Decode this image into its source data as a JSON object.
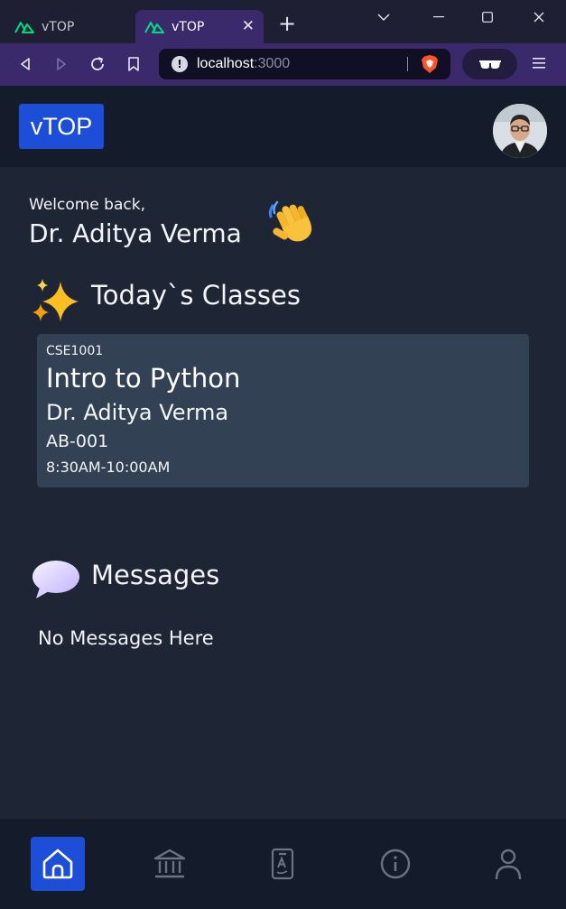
{
  "browser": {
    "tabs": [
      {
        "title": "vTOP",
        "active": false
      },
      {
        "title": "vTOP",
        "active": true
      }
    ],
    "url_host": "localhost",
    "url_port": ":3000"
  },
  "app": {
    "logo": "vTOP",
    "welcome_line": "Welcome back,",
    "user_name": "Dr. Aditya Verma",
    "classes_title": "Today`s Classes",
    "classes": [
      {
        "code": "CSE1001",
        "name": "Intro to Python",
        "faculty": "Dr. Aditya Verma",
        "room": "AB-001",
        "time": "8:30AM-10:00AM"
      }
    ],
    "messages_title": "Messages",
    "messages_empty": "No Messages Here"
  },
  "bottom_nav": {
    "items": [
      {
        "icon": "home-icon",
        "active": true
      },
      {
        "icon": "bank-icon",
        "active": false
      },
      {
        "icon": "grades-document-icon",
        "active": false
      },
      {
        "icon": "info-icon",
        "active": false
      },
      {
        "icon": "user-icon",
        "active": false
      }
    ]
  },
  "colors": {
    "accent": "#1d4ed8",
    "background": "#1e2535",
    "header": "#141c2c",
    "card": "#334155",
    "browser_purple": "#3a2a6c"
  }
}
